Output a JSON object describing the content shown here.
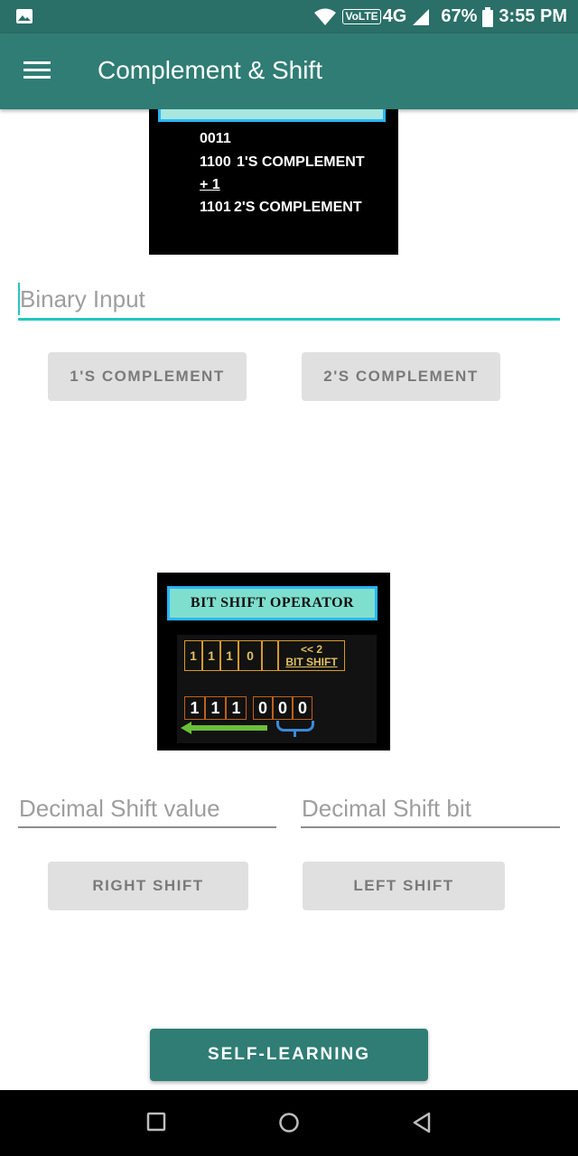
{
  "status": {
    "network": "4G",
    "volte": "VoLTE",
    "battery": "67%",
    "time": "3:55 PM"
  },
  "app_bar": {
    "title": "Complement & Shift"
  },
  "complement_image": {
    "lines": [
      "0011",
      "1100",
      "1'S COMPLEMENT",
      "+  1",
      "1101",
      "2'S COMPLEMENT"
    ]
  },
  "binary_input": {
    "placeholder": "Binary Input",
    "value": ""
  },
  "buttons": {
    "ones_complement": "1'S COMPLEMENT",
    "twos_complement": "2'S COMPLEMENT",
    "right_shift": "RIGHT SHIFT",
    "left_shift": "LEFT SHIFT",
    "self_learning": "SELF-LEARNING"
  },
  "shift_image": {
    "title": "BIT SHIFT OPERATOR",
    "top_bits": [
      "1",
      "1",
      "1",
      "0"
    ],
    "shift_label_1": "<< 2",
    "shift_label_2": "BIT SHIFT",
    "result_bits": [
      "1",
      "1",
      "1",
      "0",
      "0",
      "0"
    ]
  },
  "decimal_shift_value": {
    "placeholder": "Decimal Shift value"
  },
  "decimal_shift_bit": {
    "placeholder": "Decimal Shift bit"
  },
  "colors": {
    "primary": "#2f7d74",
    "status_bar": "#2a6f68",
    "accent": "#26c6c0"
  }
}
